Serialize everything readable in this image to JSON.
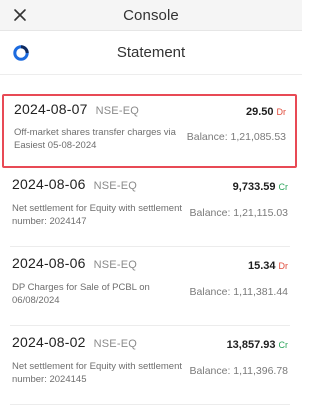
{
  "header": {
    "title": "Console"
  },
  "subheader": {
    "title": "Statement"
  },
  "colors": {
    "debit": "#e04b3b",
    "credit": "#2aa35a",
    "highlight": "#e84a55",
    "brand": "#1c6bdf"
  },
  "transactions": [
    {
      "date": "2024-08-07",
      "exchange": "NSE-EQ",
      "amount": "29.50",
      "type": "Dr",
      "description": "Off-market shares transfer charges via Easiest 05-08-2024",
      "balance": "Balance: 1,21,085.53"
    },
    {
      "date": "2024-08-06",
      "exchange": "NSE-EQ",
      "amount": "9,733.59",
      "type": "Cr",
      "description": "Net settlement for Equity with settlement number: 2024147",
      "balance": "Balance: 1,21,115.03"
    },
    {
      "date": "2024-08-06",
      "exchange": "NSE-EQ",
      "amount": "15.34",
      "type": "Dr",
      "description": "DP Charges for Sale of PCBL on 06/08/2024",
      "balance": "Balance: 1,11,381.44"
    },
    {
      "date": "2024-08-02",
      "exchange": "NSE-EQ",
      "amount": "13,857.93",
      "type": "Cr",
      "description": "Net settlement for Equity with settlement number: 2024145",
      "balance": "Balance: 1,11,396.78"
    }
  ]
}
